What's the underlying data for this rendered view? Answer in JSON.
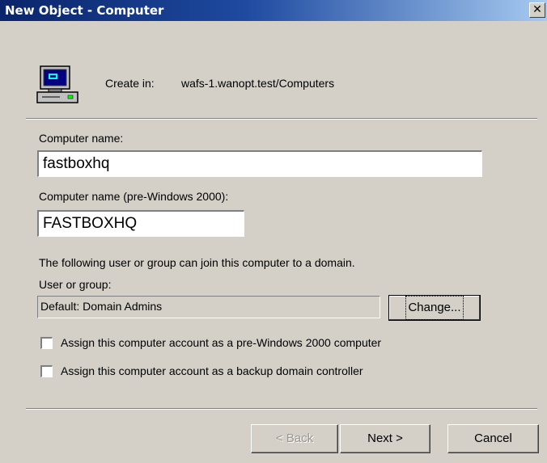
{
  "window": {
    "title": "New Object - Computer",
    "close_glyph": "✕"
  },
  "header": {
    "icon": "computer-icon",
    "create_in_label": "Create in:",
    "create_in_value": "wafs-1.wanopt.test/Computers"
  },
  "form": {
    "computer_name_label": "Computer name:",
    "computer_name_value": "fastboxhq",
    "pre2000_label": "Computer name (pre-Windows 2000):",
    "pre2000_value": "FASTBOXHQ",
    "join_info": "The following user or group can join this computer to a domain.",
    "user_group_label": "User or group:",
    "user_group_value": "Default: Domain Admins",
    "change_button": "Change...",
    "checkbox_pre2000": {
      "label": "Assign this computer account as a pre-Windows 2000 computer",
      "checked": false
    },
    "checkbox_bdc": {
      "label": "Assign this computer account as a backup domain controller",
      "checked": false
    }
  },
  "footer": {
    "back_button": "< Back",
    "next_button": "Next >",
    "cancel_button": "Cancel"
  }
}
